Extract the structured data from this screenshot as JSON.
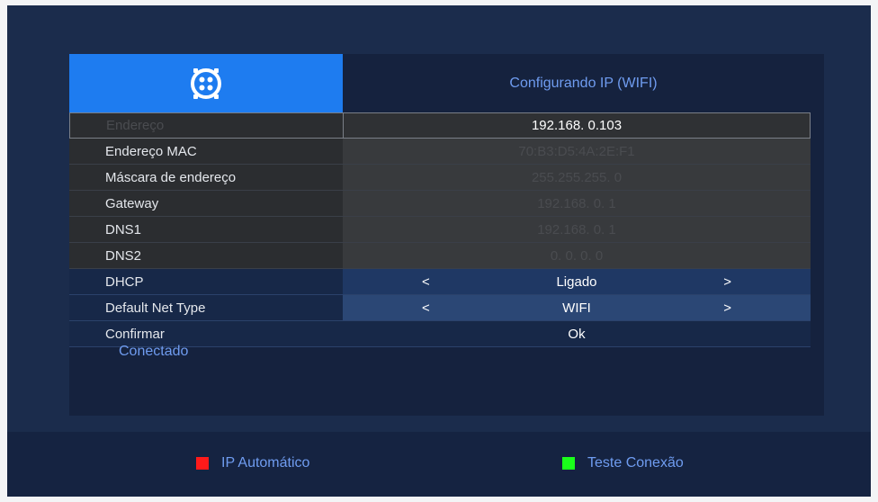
{
  "header": {
    "title": "Configurando IP (WIFI)",
    "logo_icon": "router-logo-icon"
  },
  "rows": [
    {
      "label": "Endereço",
      "value": "192.168.  0.103"
    },
    {
      "label": "Endereço MAC",
      "value": "70:B3:D5:4A:2E:F1"
    },
    {
      "label": "Máscara de endereço",
      "value": "255.255.255.  0"
    },
    {
      "label": "Gateway",
      "value": "192.168.  0.  1"
    },
    {
      "label": "DNS1",
      "value": "192.168.  0.  1"
    },
    {
      "label": "DNS2",
      "value": "  0.  0.  0.  0"
    },
    {
      "label": "DHCP",
      "value": "Ligado",
      "left": "<",
      "right": ">"
    },
    {
      "label": "Default Net Type",
      "value": "WIFI",
      "left": "<",
      "right": ">"
    },
    {
      "label": "Confirmar",
      "value": "Ok"
    }
  ],
  "status": "Conectado",
  "footer": {
    "keys": [
      {
        "label": "IP Automático",
        "color": "#ff1a1a"
      },
      {
        "label": "Teste Conexão",
        "color": "#1aff1a"
      }
    ]
  }
}
